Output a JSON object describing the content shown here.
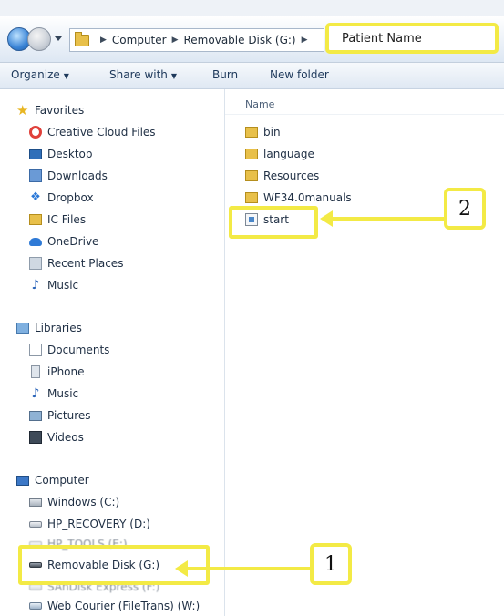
{
  "address_bar": {
    "breadcrumbs": [
      "Computer",
      "Removable Disk (G:)"
    ],
    "annotation_text": "Patient Name"
  },
  "toolbar": {
    "organize": "Organize",
    "share_with": "Share with",
    "burn": "Burn",
    "new_folder": "New folder"
  },
  "nav_pane": {
    "favorites": {
      "label": "Favorites",
      "items": [
        "Creative Cloud Files",
        "Desktop",
        "Downloads",
        "Dropbox",
        "IC Files",
        "OneDrive",
        "Recent Places",
        "Music"
      ]
    },
    "libraries": {
      "label": "Libraries",
      "items": [
        "Documents",
        "iPhone",
        "Music",
        "Pictures",
        "Videos"
      ]
    },
    "computer": {
      "label": "Computer",
      "items": [
        "Windows (C:)",
        "HP_RECOVERY (D:)",
        "HP_TOOLS (E:)",
        "Removable Disk (G:)",
        "SAnDisk Express (F:)",
        "Web Courier (FileTrans) (W:)"
      ]
    }
  },
  "content": {
    "column_header": "Name",
    "files": [
      "bin",
      "language",
      "Resources",
      "WF34.0manuals",
      "start"
    ]
  },
  "callouts": [
    "1",
    "2"
  ],
  "colors": {
    "highlight": "#f3ea45"
  }
}
